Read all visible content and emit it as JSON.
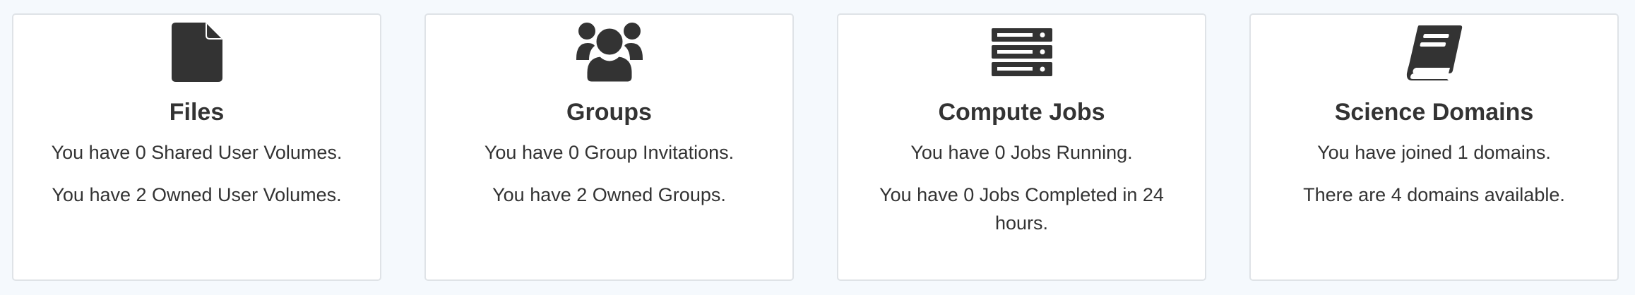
{
  "cards": [
    {
      "icon": "file-icon",
      "title": "Files",
      "lines": [
        "You have 0 Shared User Volumes.",
        "You have 2 Owned User Volumes."
      ]
    },
    {
      "icon": "users-icon",
      "title": "Groups",
      "lines": [
        "You have 0 Group Invitations.",
        "You have 2 Owned Groups."
      ]
    },
    {
      "icon": "server-icon",
      "title": "Compute Jobs",
      "lines": [
        "You have 0 Jobs Running.",
        "You have 0 Jobs Completed in 24 hours."
      ]
    },
    {
      "icon": "book-icon",
      "title": "Science Domains",
      "lines": [
        "You have joined 1 domains.",
        "There are 4 domains available."
      ]
    }
  ],
  "colors": {
    "page_background": "#f5f9fd",
    "card_background": "#ffffff",
    "card_border": "#dfe3e7",
    "text": "#333333",
    "icon": "#333333"
  }
}
